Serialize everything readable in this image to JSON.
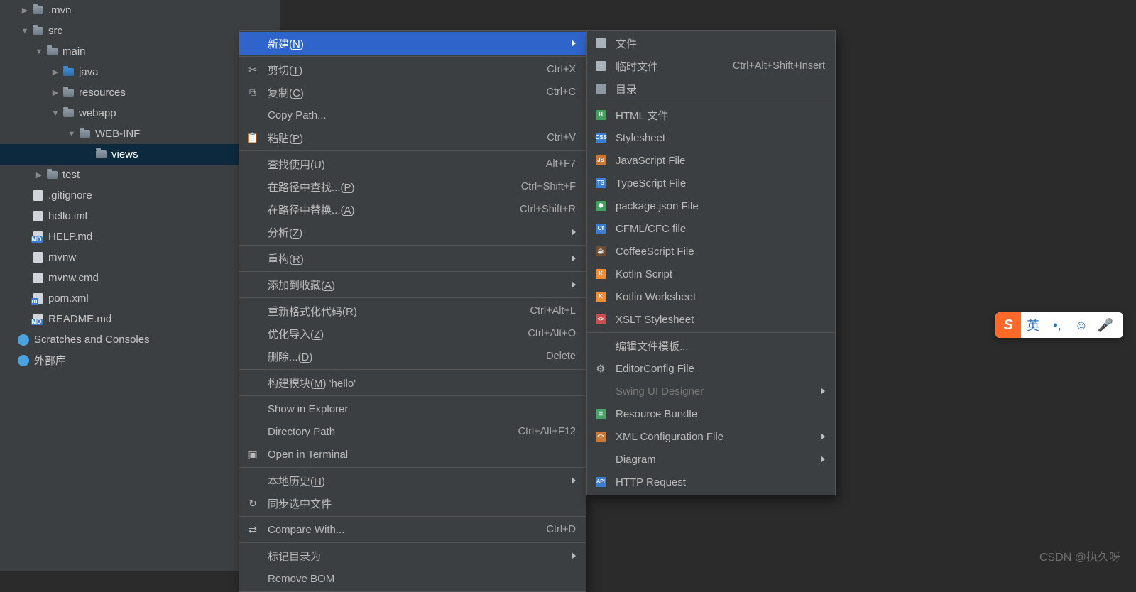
{
  "tree": [
    {
      "indent": 20,
      "arrow": "▶",
      "icon": "folder",
      "label": ".mvn"
    },
    {
      "indent": 20,
      "arrow": "▼",
      "icon": "folder",
      "label": "src"
    },
    {
      "indent": 40,
      "arrow": "▼",
      "icon": "folder",
      "label": "main"
    },
    {
      "indent": 63,
      "arrow": "▶",
      "icon": "folder-blue",
      "label": "java"
    },
    {
      "indent": 63,
      "arrow": "▶",
      "icon": "folder",
      "label": "resources"
    },
    {
      "indent": 63,
      "arrow": "▼",
      "icon": "folder",
      "label": "webapp"
    },
    {
      "indent": 86,
      "arrow": "▼",
      "icon": "folder",
      "label": "WEB-INF"
    },
    {
      "indent": 109,
      "arrow": "",
      "icon": "folder",
      "label": "views",
      "selected": true
    },
    {
      "indent": 40,
      "arrow": "▶",
      "icon": "folder",
      "label": "test"
    },
    {
      "indent": 20,
      "arrow": "",
      "icon": "file-git",
      "label": ".gitignore"
    },
    {
      "indent": 20,
      "arrow": "",
      "icon": "file",
      "label": "hello.iml"
    },
    {
      "indent": 20,
      "arrow": "",
      "icon": "file-md",
      "label": "HELP.md"
    },
    {
      "indent": 20,
      "arrow": "",
      "icon": "file",
      "label": "mvnw"
    },
    {
      "indent": 20,
      "arrow": "",
      "icon": "file",
      "label": "mvnw.cmd"
    },
    {
      "indent": 20,
      "arrow": "",
      "icon": "file-m",
      "label": "pom.xml"
    },
    {
      "indent": 20,
      "arrow": "",
      "icon": "file-md",
      "label": "README.md"
    },
    {
      "indent": 0,
      "arrow": "",
      "icon": "special",
      "label": "Scratches and Consoles"
    },
    {
      "indent": 0,
      "arrow": "",
      "icon": "special",
      "label": "外部库"
    }
  ],
  "menu1": [
    {
      "type": "item",
      "icon": "",
      "label_pre": "新建(",
      "underline": "N",
      "label_post": ")",
      "sub": true,
      "highlight": true
    },
    {
      "type": "sep"
    },
    {
      "type": "item",
      "icon": "cut",
      "label_pre": "剪切(",
      "underline": "T",
      "label_post": ")",
      "short": "Ctrl+X"
    },
    {
      "type": "item",
      "icon": "copy",
      "label_pre": "复制(",
      "underline": "C",
      "label_post": ")",
      "short": "Ctrl+C"
    },
    {
      "type": "item",
      "icon": "",
      "label": "Copy Path..."
    },
    {
      "type": "item",
      "icon": "paste",
      "label_pre": "粘贴(",
      "underline": "P",
      "label_post": ")",
      "short": "Ctrl+V"
    },
    {
      "type": "sep"
    },
    {
      "type": "item",
      "icon": "",
      "label_pre": "查找使用(",
      "underline": "U",
      "label_post": ")",
      "short": "Alt+F7"
    },
    {
      "type": "item",
      "icon": "",
      "label_pre": "在路径中查找...(",
      "underline": "P",
      "label_post": ")",
      "short": "Ctrl+Shift+F"
    },
    {
      "type": "item",
      "icon": "",
      "label_pre": "在路径中替换...(",
      "underline": "A",
      "label_post": ")",
      "short": "Ctrl+Shift+R"
    },
    {
      "type": "item",
      "icon": "",
      "label_pre": "分析(",
      "underline": "Z",
      "label_post": ")",
      "sub": true
    },
    {
      "type": "sep"
    },
    {
      "type": "item",
      "icon": "",
      "label_pre": "重构(",
      "underline": "R",
      "label_post": ")",
      "sub": true
    },
    {
      "type": "sep"
    },
    {
      "type": "item",
      "icon": "",
      "label_pre": "添加到收藏(",
      "underline": "A",
      "label_post": ")",
      "sub": true
    },
    {
      "type": "sep"
    },
    {
      "type": "item",
      "icon": "",
      "label_pre": "重新格式化代码(",
      "underline": "R",
      "label_post": ")",
      "short": "Ctrl+Alt+L"
    },
    {
      "type": "item",
      "icon": "",
      "label_pre": "优化导入(",
      "underline": "Z",
      "label_post": ")",
      "short": "Ctrl+Alt+O"
    },
    {
      "type": "item",
      "icon": "",
      "label_pre": "删除...(",
      "underline": "D",
      "label_post": ")",
      "short": "Delete"
    },
    {
      "type": "sep"
    },
    {
      "type": "item",
      "icon": "",
      "label_pre": "构建模块(",
      "underline": "M",
      "label_post": ") 'hello'"
    },
    {
      "type": "sep"
    },
    {
      "type": "item",
      "icon": "",
      "label": "Show in Explorer"
    },
    {
      "type": "item",
      "icon": "",
      "label_pre": "Directory ",
      "underline": "P",
      "label_post": "ath",
      "short": "Ctrl+Alt+F12"
    },
    {
      "type": "item",
      "icon": "terminal",
      "label": "Open in Terminal"
    },
    {
      "type": "sep"
    },
    {
      "type": "item",
      "icon": "",
      "label_pre": "本地历史(",
      "underline": "H",
      "label_post": ")",
      "sub": true
    },
    {
      "type": "item",
      "icon": "sync",
      "label": "同步选中文件"
    },
    {
      "type": "sep"
    },
    {
      "type": "item",
      "icon": "diff",
      "label": "Compare With...",
      "short": "Ctrl+D"
    },
    {
      "type": "sep"
    },
    {
      "type": "item",
      "icon": "",
      "label": "标记目录为",
      "sub": true
    },
    {
      "type": "item",
      "icon": "",
      "label": "Remove BOM"
    }
  ],
  "menu2": [
    {
      "type": "item",
      "icon": "file",
      "label": "文件"
    },
    {
      "type": "item",
      "icon": "clock",
      "label": "临时文件",
      "short": "Ctrl+Alt+Shift+Insert"
    },
    {
      "type": "item",
      "icon": "folder",
      "label": "目录"
    },
    {
      "type": "sep"
    },
    {
      "type": "item",
      "icon": "html",
      "label": "HTML 文件"
    },
    {
      "type": "item",
      "icon": "css",
      "label": "Stylesheet"
    },
    {
      "type": "item",
      "icon": "js",
      "label": "JavaScript File"
    },
    {
      "type": "item",
      "icon": "ts",
      "label": "TypeScript File"
    },
    {
      "type": "item",
      "icon": "pkg",
      "label": "package.json File"
    },
    {
      "type": "item",
      "icon": "cf",
      "label": "CFML/CFC file"
    },
    {
      "type": "item",
      "icon": "coffee",
      "label": "CoffeeScript File"
    },
    {
      "type": "item",
      "icon": "kotlin",
      "label": "Kotlin Script"
    },
    {
      "type": "item",
      "icon": "kotlin",
      "label": "Kotlin Worksheet"
    },
    {
      "type": "item",
      "icon": "xslt",
      "label": "XSLT Stylesheet"
    },
    {
      "type": "sep"
    },
    {
      "type": "item",
      "icon": "",
      "label": "编辑文件模板..."
    },
    {
      "type": "item",
      "icon": "gear",
      "label": "EditorConfig File"
    },
    {
      "type": "item",
      "icon": "",
      "label": "Swing UI Designer",
      "sub": true,
      "disabled": true
    },
    {
      "type": "item",
      "icon": "bundle",
      "label": "Resource Bundle"
    },
    {
      "type": "item",
      "icon": "xml",
      "label": "XML Configuration File",
      "sub": true
    },
    {
      "type": "item",
      "icon": "",
      "label": "Diagram",
      "sub": true
    },
    {
      "type": "item",
      "icon": "api",
      "label": "HTTP Request"
    }
  ],
  "ime": {
    "ch": "英"
  },
  "watermark": "CSDN @执久呀"
}
